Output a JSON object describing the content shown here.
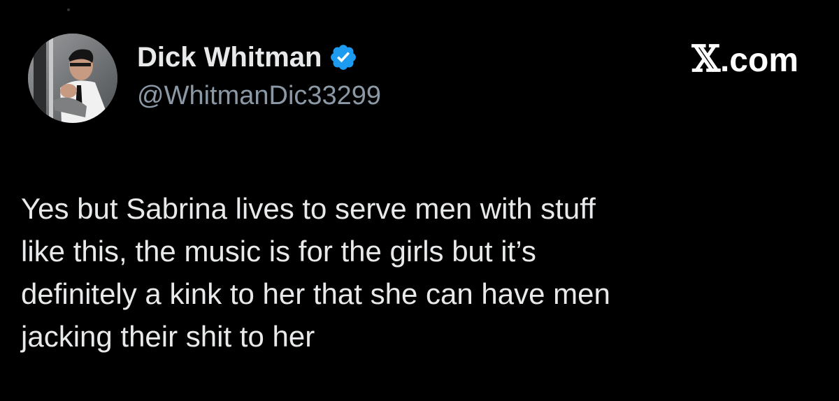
{
  "tweet": {
    "author": {
      "display_name": "Dick Whitman",
      "handle": "@WhitmanDic33299",
      "verified": true,
      "avatar_icon": "profile-photo"
    },
    "brand": {
      "glyph": "𝕏",
      "suffix": ".com"
    },
    "body_text": "Yes but Sabrina lives to serve men with stuff\nlike this, the music is for the girls but it’s\ndefinitely a kink to her that she can have men\njacking their shit to her"
  },
  "colors": {
    "background": "#000000",
    "text_primary": "#e7e9ea",
    "text_secondary": "#8b98a5",
    "verified_badge": "#1d9bf0"
  }
}
